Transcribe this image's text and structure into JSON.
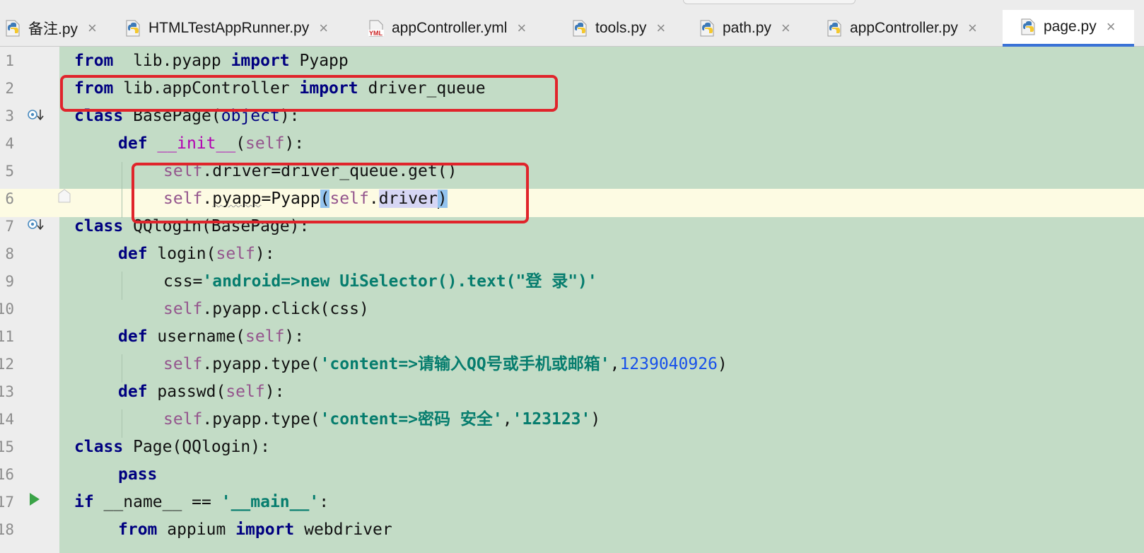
{
  "tabs": [
    {
      "label": "备注.py",
      "icon": "python-file-icon",
      "active": false
    },
    {
      "label": "HTMLTestAppRunner.py",
      "icon": "python-file-icon",
      "active": false
    },
    {
      "label": "appController.yml",
      "icon": "yml-file-icon",
      "icon_text": "YML",
      "active": false
    },
    {
      "label": "tools.py",
      "icon": "python-file-icon",
      "active": false
    },
    {
      "label": "path.py",
      "icon": "python-file-icon",
      "active": false
    },
    {
      "label": "appController.py",
      "icon": "python-file-icon",
      "active": false
    },
    {
      "label": "page.py",
      "icon": "python-file-icon",
      "active": true
    }
  ],
  "close_glyph": "×",
  "line_numbers": [
    "1",
    "2",
    "3",
    "4",
    "5",
    "6",
    "7",
    "8",
    "9",
    "10",
    "11",
    "12",
    "13",
    "14",
    "15",
    "16",
    "17",
    "18"
  ],
  "code": {
    "l1": {
      "kw1": "from",
      "t1": "  lib.pyapp ",
      "kw2": "import",
      "t2": " Pyapp"
    },
    "l2": {
      "kw1": "from",
      "t1": " lib.appController ",
      "kw2": "import",
      "t2": " driver_queue"
    },
    "l3": {
      "kw1": "class",
      "t1": " BasePage(",
      "builtin": "object",
      "t2": "):"
    },
    "l4": {
      "kw1": "def",
      "t0": " ",
      "magic": "__init__",
      "t1": "(",
      "self": "self",
      "t2": "):"
    },
    "l5": {
      "self": "self",
      "t1": ".driver=driver_queue.get()"
    },
    "l6": {
      "self1": "self",
      "t1": ".",
      "squig": "pyapp",
      "t2": "=Pyapp",
      "paren_open": "(",
      "self2": "self",
      "t3": ".",
      "ident": "driver",
      "paren_close": ")"
    },
    "l7": {
      "kw1": "class",
      "t1": " QQlogin(BasePage):"
    },
    "l8": {
      "kw1": "def",
      "t1": " login(",
      "self": "self",
      "t2": "):"
    },
    "l9": {
      "t1": "css=",
      "str": "'android=>new UiSelector().text(\"登 录\")'"
    },
    "l10": {
      "self": "self",
      "t1": ".pyapp.click(css)"
    },
    "l11": {
      "kw1": "def",
      "t1": " username(",
      "self": "self",
      "t2": "):"
    },
    "l12": {
      "self": "self",
      "t1": ".pyapp.type(",
      "str": "'content=>请输入QQ号或手机或邮箱'",
      "t2": ",",
      "num": "1239040926",
      "t3": ")"
    },
    "l13": {
      "kw1": "def",
      "t1": " passwd(",
      "self": "self",
      "t2": "):"
    },
    "l14": {
      "self": "self",
      "t1": ".pyapp.type(",
      "str1": "'content=>密码 安全'",
      "t2": ",",
      "str2": "'123123'",
      "t3": ")"
    },
    "l15": {
      "kw1": "class",
      "t1": " Page(QQlogin):"
    },
    "l16": {
      "kw1": "pass"
    },
    "l17": {
      "kw1": "if",
      "t1": " __name__ == ",
      "str": "'__main__'",
      "t2": ":"
    },
    "l18": {
      "kw1": "from",
      "t1": " appium ",
      "kw2": "import",
      "t2": " webdriver"
    }
  },
  "colors": {
    "editor_background": "#c3dcc6",
    "keyword": "#000080",
    "self": "#94558d",
    "string": "#067d6e",
    "number": "#1750eb",
    "highlight_box": "#e0242b",
    "active_tab_underline": "#3a72d6"
  }
}
